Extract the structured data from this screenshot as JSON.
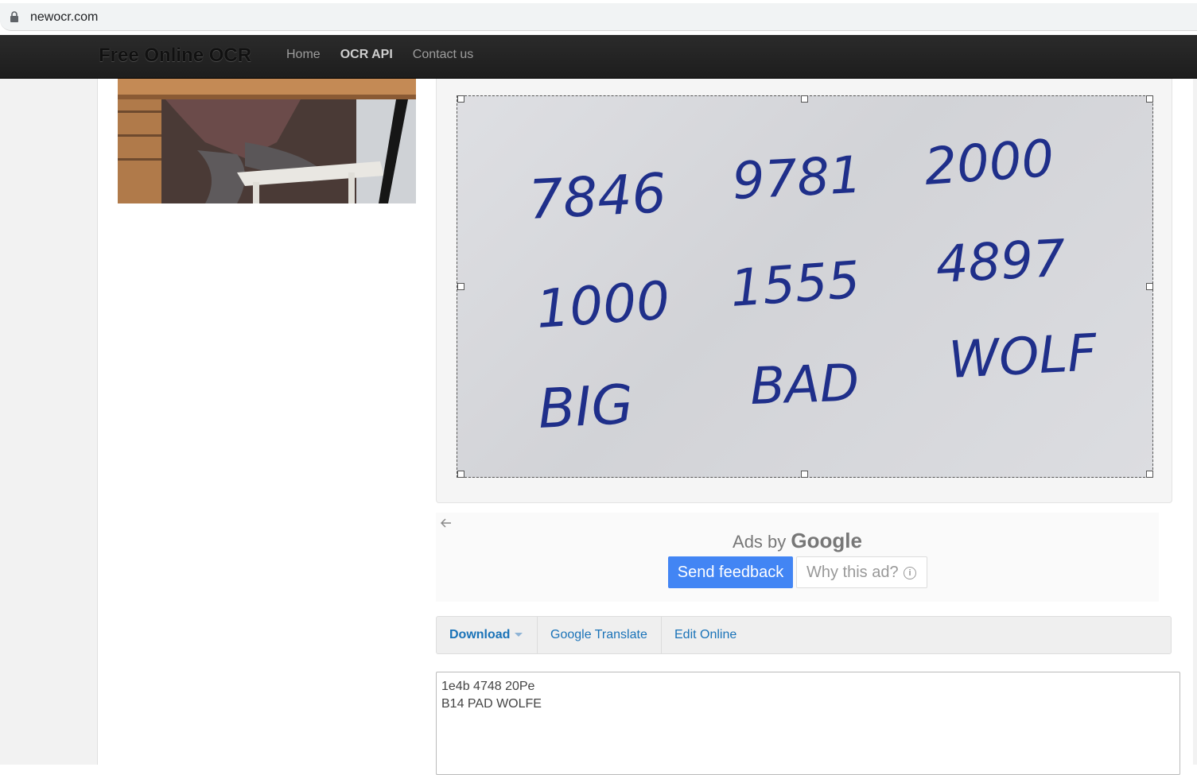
{
  "browser": {
    "url": "newocr.com"
  },
  "navbar": {
    "brand": "Free Online OCR",
    "links": [
      {
        "label": "Home",
        "active": false
      },
      {
        "label": "OCR API",
        "active": true
      },
      {
        "label": "Contact us",
        "active": false
      }
    ]
  },
  "image": {
    "handwriting": [
      "7846",
      "9781",
      "2000",
      "1000",
      "1555",
      "4897",
      "BIG",
      "BAD",
      "WOLF"
    ]
  },
  "ad": {
    "ads_by": "Ads by",
    "google": "Google",
    "send_feedback": "Send feedback",
    "why_this_ad": "Why this ad?"
  },
  "toolbar": {
    "download": "Download",
    "google_translate": "Google Translate",
    "edit_online": "Edit Online"
  },
  "result": {
    "text": "1e4b 4748 20Pe\nB14 PAD WOLFE"
  },
  "colors": {
    "ink": "#1f2f8a",
    "link": "#1a73b8",
    "feedback_button": "#4285f4",
    "navbar": "#222222"
  }
}
